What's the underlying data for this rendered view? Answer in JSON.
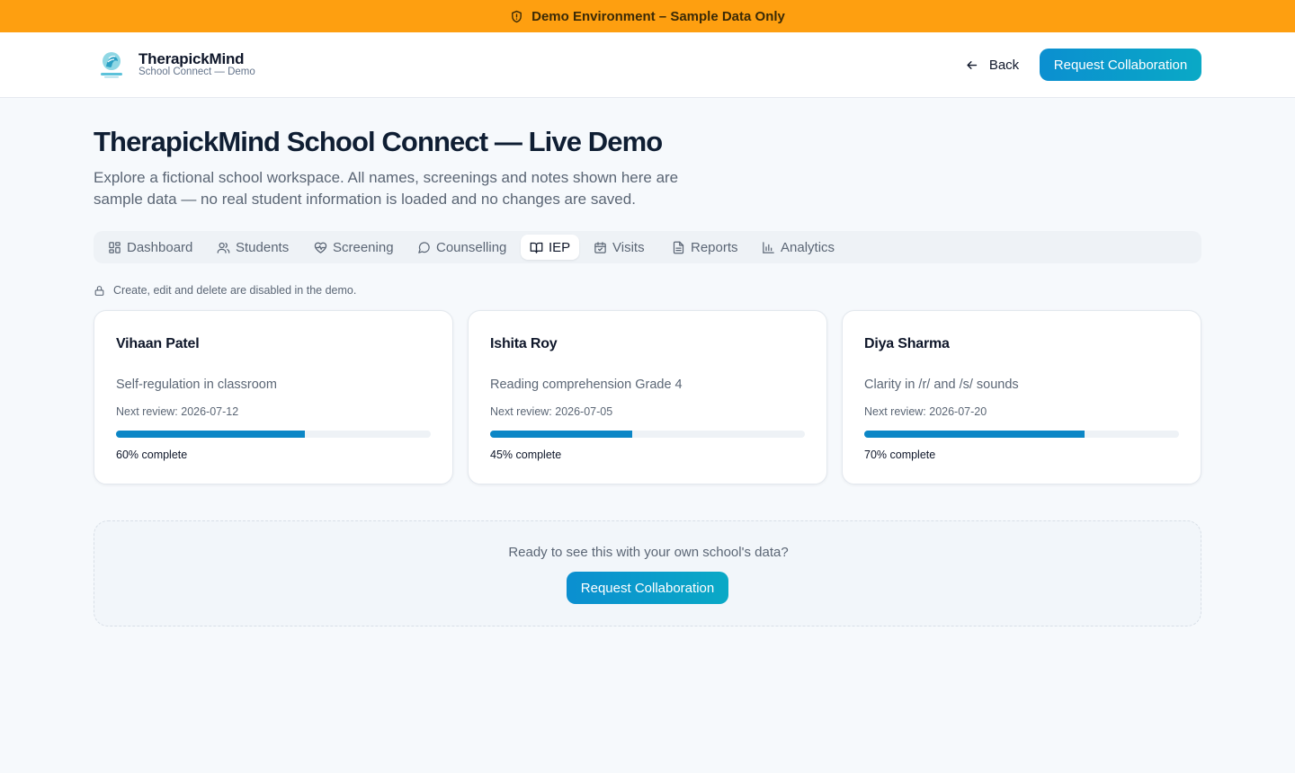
{
  "banner": {
    "icon": "shield-alert-icon",
    "text": "Demo Environment – Sample Data Only",
    "color": "#fe9f10"
  },
  "header": {
    "brand_name": "TherapickMind",
    "brand_sub": "School Connect — Demo",
    "back_label": "Back",
    "cta_label": "Request Collaboration"
  },
  "main": {
    "title": "TherapickMind School Connect — Live Demo",
    "description": "Explore a fictional school workspace. All names, screenings and notes shown here are sample data — no real student information is loaded and no changes are saved.",
    "tabs": [
      {
        "label": "Dashboard",
        "icon": "dashboard-icon",
        "active": false
      },
      {
        "label": "Students",
        "icon": "users-icon",
        "active": false
      },
      {
        "label": "Screening",
        "icon": "heart-pulse-icon",
        "active": false
      },
      {
        "label": "Counselling",
        "icon": "chat-bubble-icon",
        "active": false
      },
      {
        "label": "IEP",
        "icon": "book-open-icon",
        "active": true
      },
      {
        "label": "Visits",
        "icon": "calendar-check-icon",
        "active": false
      },
      {
        "label": "Reports",
        "icon": "document-icon",
        "active": false
      },
      {
        "label": "Analytics",
        "icon": "bar-chart-icon",
        "active": false
      }
    ],
    "notice": "Create, edit and delete are disabled in the demo.",
    "cards": [
      {
        "name": "Vihaan Patel",
        "goal": "Self-regulation in classroom",
        "review": "Next review: 2026-07-12",
        "progress": 60,
        "progress_label": "60% complete"
      },
      {
        "name": "Ishita Roy",
        "goal": "Reading comprehension Grade 4",
        "review": "Next review: 2026-07-05",
        "progress": 45,
        "progress_label": "45% complete"
      },
      {
        "name": "Diya Sharma",
        "goal": "Clarity in /r/ and /s/ sounds",
        "review": "Next review: 2026-07-20",
        "progress": 70,
        "progress_label": "70% complete"
      }
    ],
    "cta_box": {
      "text": "Ready to see this with your own school's data?",
      "button_label": "Request Collaboration"
    }
  },
  "colors": {
    "accent": "#0b86c6",
    "banner": "#fe9f10"
  }
}
